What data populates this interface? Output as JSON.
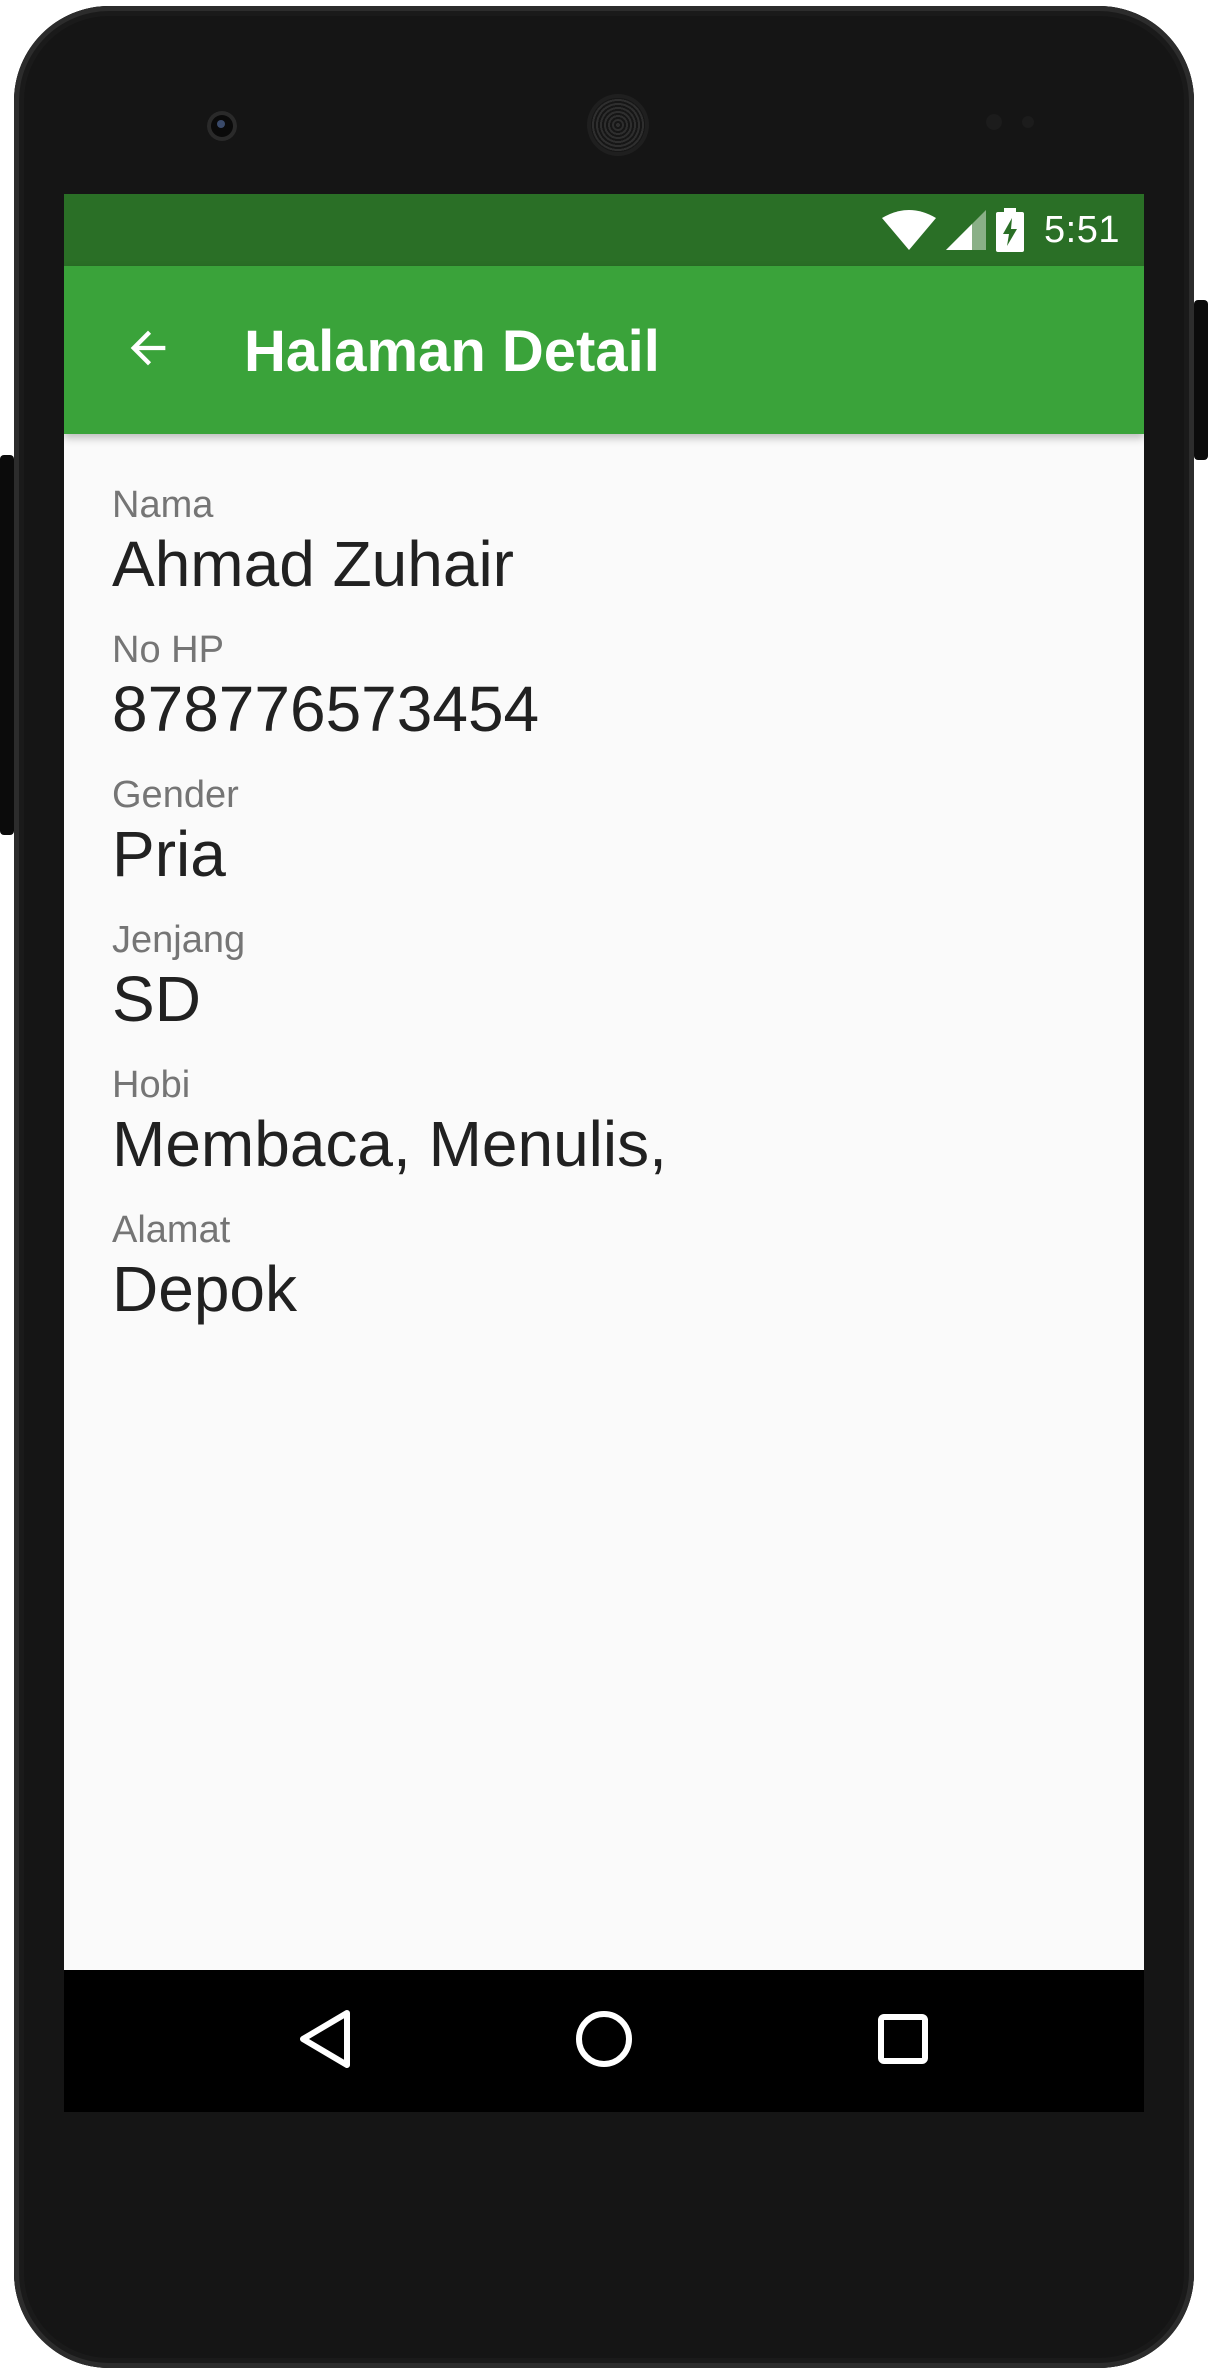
{
  "status_bar": {
    "time": "5:51",
    "icons": [
      "wifi-icon",
      "cell-signal-icon",
      "battery-charging-icon"
    ]
  },
  "app_bar": {
    "back_icon": "arrow-back-icon",
    "title": "Halaman Detail"
  },
  "detail": {
    "fields": [
      {
        "label": "Nama",
        "value": "Ahmad Zuhair"
      },
      {
        "label": "No HP",
        "value": "878776573454"
      },
      {
        "label": "Gender",
        "value": "Pria"
      },
      {
        "label": "Jenjang",
        "value": "SD"
      },
      {
        "label": "Hobi",
        "value": "Membaca, Menulis,"
      },
      {
        "label": "Alamat",
        "value": "Depok"
      }
    ]
  },
  "nav_bar": {
    "icons": [
      "nav-back-icon",
      "nav-home-icon",
      "nav-recents-icon"
    ]
  },
  "colors": {
    "status_bar": "#2a6f26",
    "app_bar": "#3aa33a",
    "screen_background": "#fafafa",
    "label_text": "#757575",
    "value_text": "#212121"
  }
}
